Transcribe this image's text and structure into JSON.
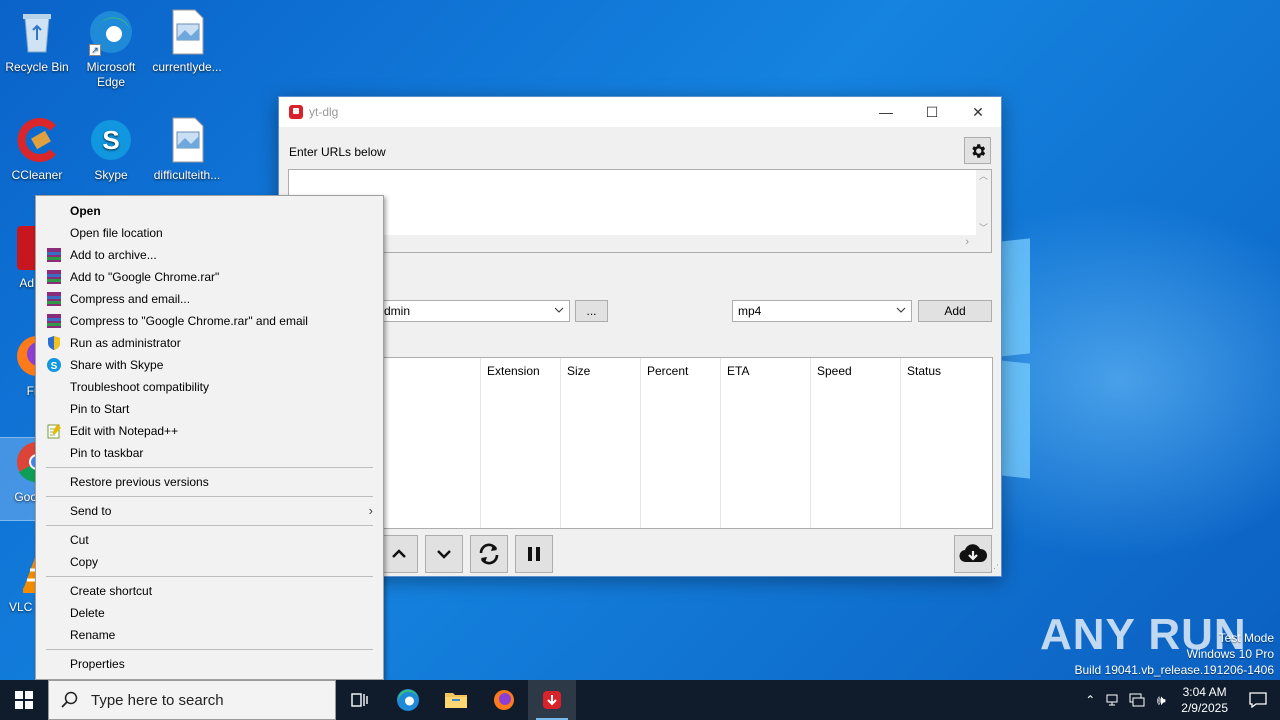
{
  "desktop": {
    "icons": [
      {
        "label": "Recycle Bin"
      },
      {
        "label": "Microsoft Edge"
      },
      {
        "label": "currentlyde..."
      },
      {
        "label": "CCleaner"
      },
      {
        "label": "Skype"
      },
      {
        "label": "difficulteith..."
      },
      {
        "label": "Ad Acr"
      },
      {
        "label": "Fire"
      },
      {
        "label": "Goo Chr"
      },
      {
        "label": "VLC m pla"
      }
    ]
  },
  "ytdlg": {
    "title": "yt-dlg",
    "url_label": "Enter URLs below",
    "path_value": "dmin",
    "browse_label": "...",
    "format_value": "mp4",
    "add_label": "Add",
    "columns": [
      "Extension",
      "Size",
      "Percent",
      "ETA",
      "Speed",
      "Status"
    ]
  },
  "context_menu": {
    "items": [
      {
        "label": "Open"
      },
      {
        "label": "Open file location"
      },
      {
        "label": "Add to archive..."
      },
      {
        "label": "Add to \"Google Chrome.rar\""
      },
      {
        "label": "Compress and email..."
      },
      {
        "label": "Compress to \"Google Chrome.rar\" and email"
      },
      {
        "label": "Run as administrator"
      },
      {
        "label": "Share with Skype"
      },
      {
        "label": "Troubleshoot compatibility"
      },
      {
        "label": "Pin to Start"
      },
      {
        "label": "Edit with Notepad++"
      },
      {
        "label": "Pin to taskbar"
      },
      {
        "label": "Restore previous versions"
      },
      {
        "label": "Send to"
      },
      {
        "label": "Cut"
      },
      {
        "label": "Copy"
      },
      {
        "label": "Create shortcut"
      },
      {
        "label": "Delete"
      },
      {
        "label": "Rename"
      },
      {
        "label": "Properties"
      }
    ]
  },
  "watermark": {
    "brand": "ANY RUN",
    "line1": "Test Mode",
    "line2": "Windows 10 Pro",
    "line3": "Build 19041.vb_release.191206-1406"
  },
  "taskbar": {
    "search_placeholder": "Type here to search",
    "time": "3:04 AM",
    "date": "2/9/2025"
  },
  "colors": {
    "desktop_blue": "#0a63c9",
    "taskbar": "#101c2c",
    "ytdlg_red": "#d8232a"
  }
}
